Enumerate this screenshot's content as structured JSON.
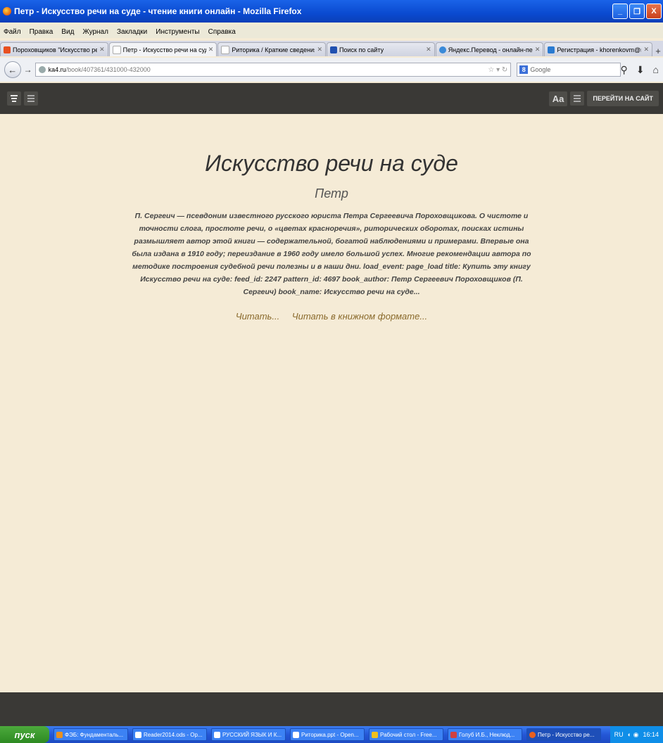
{
  "window": {
    "title": "Петр - Искусство речи на суде - чтение книги онлайн - Mozilla Firefox",
    "minimize": "_",
    "maximize": "❐",
    "close": "X"
  },
  "menu": [
    "Файл",
    "Правка",
    "Вид",
    "Журнал",
    "Закладки",
    "Инструменты",
    "Справка"
  ],
  "tabs": [
    {
      "label": "Пороховщиков \"Искусство речи н...",
      "color": "#e85020"
    },
    {
      "label": "Петр - Искусство речи на суде - ч...",
      "color": "#ffffff",
      "active": true
    },
    {
      "label": "Риторика / Краткие сведения из и...",
      "color": "#ffffff"
    },
    {
      "label": "Поиск по сайту",
      "color": "#2050b0"
    },
    {
      "label": "Яндекс.Перевод - онлайн-перево...",
      "color": "#3a8ad8"
    },
    {
      "label": "Регистрация - khorenkovm@mail.ru...",
      "color": "#2a7ad0"
    }
  ],
  "nav": {
    "url_host": "ka4.ru",
    "url_path": "/book/407361/431000-432000",
    "search_placeholder": "Google"
  },
  "reader": {
    "font_button": "Aa",
    "goto_site": "ПЕРЕЙТИ НА САЙТ"
  },
  "book": {
    "title": "Искусство речи на суде",
    "author": "Петр",
    "description": "П. Сергеич — псевдоним известного русского юриста Петра Сергеевича Пороховщикова. О чистоте и точности слога, простоте речи, о «цветах красноречия», риторических оборотах, поисках истины размышляет автор этой книги — содержательной, богатой наблюдениями и примерами. Впервые она была издана в 1910 году; переиздание в 1960 году имело большой успех. Многие рекомендации автора по методике построения судебной речи полезны и в наши дни. load_event: page_load title: Купить эту книгу Искусство речи на суде: feed_id: 2247 pattern_id: 4697 book_author: Петр Сергеевич Пороховщиков (П. Сергеич) book_name: Искусство речи на суде...",
    "read_link": "Читать...",
    "read_book_format_link": "Читать в книжном формате..."
  },
  "taskbar": {
    "start": "пуск",
    "tasks": [
      {
        "label": "ФЭБ: Фундаменталь...",
        "color": "#e89020"
      },
      {
        "label": "Reader2014.ods - Op...",
        "color": "#ffffff"
      },
      {
        "label": "РУССКИЙ ЯЗЫК И К...",
        "color": "#ffffff"
      },
      {
        "label": "Риторика.ppt - Open...",
        "color": "#ffffff"
      },
      {
        "label": "Рабочий стол - Free...",
        "color": "#f0c020"
      },
      {
        "label": "Голуб И.Б., Неклюд...",
        "color": "#d04040"
      },
      {
        "label": "Петр - Искусство ре...",
        "color": "#e86020",
        "active": true
      }
    ],
    "lang": "RU",
    "time": "16:14"
  }
}
